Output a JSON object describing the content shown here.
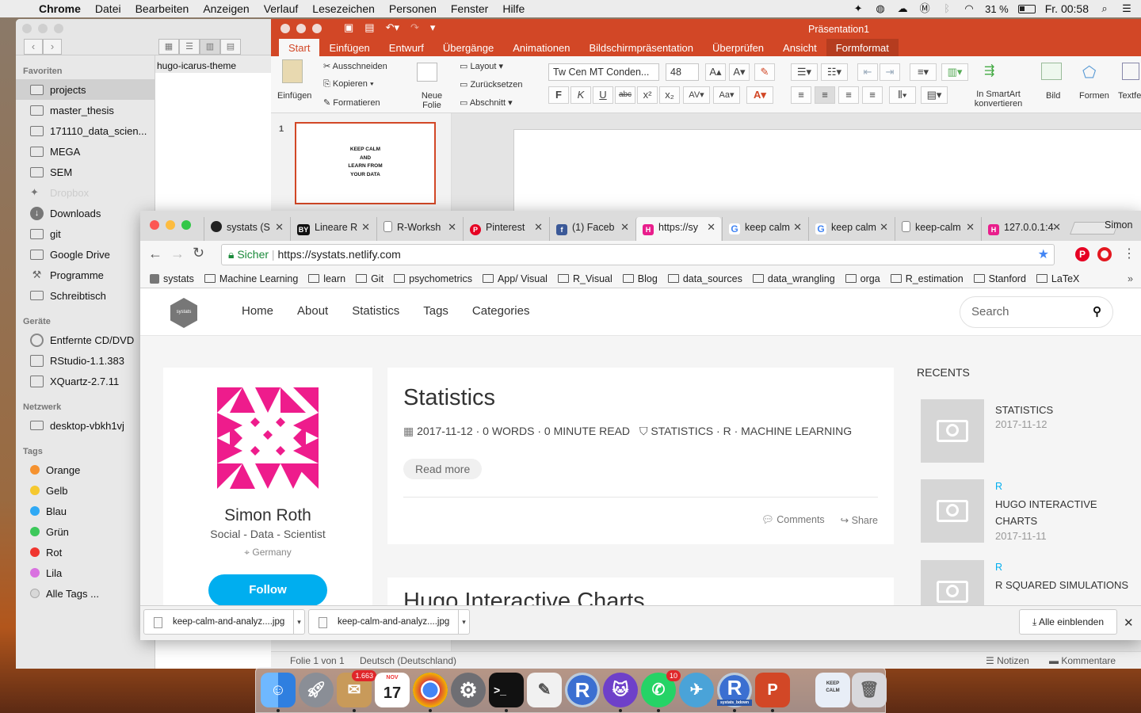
{
  "menubar": {
    "app": "Chrome",
    "items": [
      "Datei",
      "Bearbeiten",
      "Anzeigen",
      "Verlauf",
      "Lesezeichen",
      "Personen",
      "Fenster",
      "Hilfe"
    ],
    "battery": "31 %",
    "clock": "Fr. 00:58"
  },
  "finder": {
    "path_item": "hugo-icarus-theme",
    "sections": [
      {
        "header": "Favoriten",
        "items": [
          "projects",
          "master_thesis",
          "171110_data_scien...",
          "MEGA",
          "SEM",
          "Dropbox",
          "Downloads",
          "git",
          "Google Drive",
          "Programme",
          "Schreibtisch"
        ]
      },
      {
        "header": "Geräte",
        "items": [
          "Entfernte CD/DVD",
          "RStudio-1.1.383",
          "XQuartz-2.7.11"
        ]
      },
      {
        "header": "Netzwerk",
        "items": [
          "desktop-vbkh1vj"
        ]
      }
    ],
    "tags_header": "Tags",
    "tags": [
      {
        "label": "Orange",
        "color": "#f5922f"
      },
      {
        "label": "Gelb",
        "color": "#f5c82f"
      },
      {
        "label": "Blau",
        "color": "#2fa9f5"
      },
      {
        "label": "Grün",
        "color": "#3cc85a"
      },
      {
        "label": "Rot",
        "color": "#f0352f"
      },
      {
        "label": "Lila",
        "color": "#d972e0"
      },
      {
        "label": "Alle Tags ...",
        "color": "#d8d8d8"
      }
    ]
  },
  "ppt": {
    "title": "Präsentation1",
    "tabs": [
      "Start",
      "Einfügen",
      "Entwurf",
      "Übergänge",
      "Animationen",
      "Bildschirmpräsentation",
      "Überprüfen",
      "Ansicht",
      "Formformat"
    ],
    "ribbon": {
      "paste": "Einfügen",
      "cut": "Ausschneiden",
      "copy": "Kopieren",
      "format": "Formatieren",
      "new_slide": "Neue Folie",
      "layout": "Layout",
      "reset": "Zurücksetzen",
      "section": "Abschnitt",
      "font": "Tw Cen MT Conden...",
      "size": "48",
      "smartart": "In SmartArt konvertieren",
      "picture": "Bild",
      "shapes": "Formen",
      "textbox": "Textfe"
    },
    "slide_number": "1",
    "slide_text": "KEEP CALM\nAND\nLEARN FROM\nYOUR DATA",
    "status_left": "Folie 1 von 1",
    "status_lang": "Deutsch (Deutschland)",
    "notes": "Notizen",
    "comments": "Kommentare"
  },
  "chrome": {
    "tabs": [
      {
        "label": "systats (S",
        "fav": "#222",
        "glyph": "●"
      },
      {
        "label": "Lineare R",
        "fav": "#111",
        "glyph": "BY"
      },
      {
        "label": "R-Worksh",
        "fav": "#ffffff",
        "glyph": ""
      },
      {
        "label": "Pinterest",
        "fav": "#e60023",
        "glyph": "P"
      },
      {
        "label": "(1) Faceb",
        "fav": "#3b5998",
        "glyph": "f"
      },
      {
        "label": "https://sy",
        "fav": "#e91e8c",
        "glyph": "H"
      },
      {
        "label": "keep calm",
        "fav": "#4285f4",
        "glyph": "G"
      },
      {
        "label": "keep calm",
        "fav": "#4285f4",
        "glyph": "G"
      },
      {
        "label": "keep-calm",
        "fav": "#ffffff",
        "glyph": ""
      },
      {
        "label": "127.0.0.1:4",
        "fav": "#e91e8c",
        "glyph": "H"
      }
    ],
    "profile": "Simon",
    "secure": "Sicher",
    "url": "https://systats.netlify.com",
    "bookmarks": [
      "systats",
      "Machine Learning",
      "learn",
      "Git",
      "psychometrics",
      "App/ Visual",
      "R_Visual",
      "Blog",
      "data_sources",
      "data_wrangling",
      "orga",
      "R_estimation",
      "Stanford",
      "LaTeX"
    ],
    "downloads": [
      "keep-calm-and-analyz....jpg",
      "keep-calm-and-analyz....jpg"
    ],
    "show_all": "Alle einblenden"
  },
  "site": {
    "logo_text": "systats",
    "nav": [
      "Home",
      "About",
      "Statistics",
      "Tags",
      "Categories"
    ],
    "search_placeholder": "Search",
    "profile": {
      "name": "Simon Roth",
      "subtitle": "Social - Data - Scientist",
      "location": "Germany",
      "follow": "Follow"
    },
    "post": {
      "title": "Statistics",
      "meta": "2017-11-12 · 0 WORDS · 0 MINUTE READ",
      "tags": "STATISTICS · R · MACHINE LEARNING",
      "read_more": "Read more",
      "comments": "Comments",
      "share": "Share"
    },
    "post2_title": "Hugo Interactive Charts",
    "recents_title": "RECENTS",
    "recents": [
      {
        "category": "",
        "title": "STATISTICS",
        "date": "2017-11-12"
      },
      {
        "category": "R",
        "title": "HUGO INTERACTIVE CHARTS",
        "date": "2017-11-11"
      },
      {
        "category": "R",
        "title": "R SQUARED SIMULATIONS",
        "date": ""
      }
    ]
  },
  "dock": {
    "mail_badge": "1.663",
    "calendar_month": "NOV",
    "calendar_day": "17",
    "whatsapp_badge": "10",
    "r_label": "R",
    "systats_label": "systats_bdown"
  }
}
